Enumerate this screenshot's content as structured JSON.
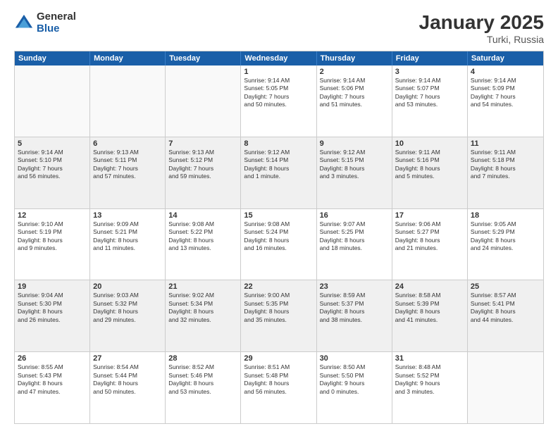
{
  "logo": {
    "general": "General",
    "blue": "Blue"
  },
  "title": "January 2025",
  "subtitle": "Turki, Russia",
  "header_days": [
    "Sunday",
    "Monday",
    "Tuesday",
    "Wednesday",
    "Thursday",
    "Friday",
    "Saturday"
  ],
  "weeks": [
    [
      {
        "day": "",
        "info": ""
      },
      {
        "day": "",
        "info": ""
      },
      {
        "day": "",
        "info": ""
      },
      {
        "day": "1",
        "info": "Sunrise: 9:14 AM\nSunset: 5:05 PM\nDaylight: 7 hours\nand 50 minutes."
      },
      {
        "day": "2",
        "info": "Sunrise: 9:14 AM\nSunset: 5:06 PM\nDaylight: 7 hours\nand 51 minutes."
      },
      {
        "day": "3",
        "info": "Sunrise: 9:14 AM\nSunset: 5:07 PM\nDaylight: 7 hours\nand 53 minutes."
      },
      {
        "day": "4",
        "info": "Sunrise: 9:14 AM\nSunset: 5:09 PM\nDaylight: 7 hours\nand 54 minutes."
      }
    ],
    [
      {
        "day": "5",
        "info": "Sunrise: 9:14 AM\nSunset: 5:10 PM\nDaylight: 7 hours\nand 56 minutes."
      },
      {
        "day": "6",
        "info": "Sunrise: 9:13 AM\nSunset: 5:11 PM\nDaylight: 7 hours\nand 57 minutes."
      },
      {
        "day": "7",
        "info": "Sunrise: 9:13 AM\nSunset: 5:12 PM\nDaylight: 7 hours\nand 59 minutes."
      },
      {
        "day": "8",
        "info": "Sunrise: 9:12 AM\nSunset: 5:14 PM\nDaylight: 8 hours\nand 1 minute."
      },
      {
        "day": "9",
        "info": "Sunrise: 9:12 AM\nSunset: 5:15 PM\nDaylight: 8 hours\nand 3 minutes."
      },
      {
        "day": "10",
        "info": "Sunrise: 9:11 AM\nSunset: 5:16 PM\nDaylight: 8 hours\nand 5 minutes."
      },
      {
        "day": "11",
        "info": "Sunrise: 9:11 AM\nSunset: 5:18 PM\nDaylight: 8 hours\nand 7 minutes."
      }
    ],
    [
      {
        "day": "12",
        "info": "Sunrise: 9:10 AM\nSunset: 5:19 PM\nDaylight: 8 hours\nand 9 minutes."
      },
      {
        "day": "13",
        "info": "Sunrise: 9:09 AM\nSunset: 5:21 PM\nDaylight: 8 hours\nand 11 minutes."
      },
      {
        "day": "14",
        "info": "Sunrise: 9:08 AM\nSunset: 5:22 PM\nDaylight: 8 hours\nand 13 minutes."
      },
      {
        "day": "15",
        "info": "Sunrise: 9:08 AM\nSunset: 5:24 PM\nDaylight: 8 hours\nand 16 minutes."
      },
      {
        "day": "16",
        "info": "Sunrise: 9:07 AM\nSunset: 5:25 PM\nDaylight: 8 hours\nand 18 minutes."
      },
      {
        "day": "17",
        "info": "Sunrise: 9:06 AM\nSunset: 5:27 PM\nDaylight: 8 hours\nand 21 minutes."
      },
      {
        "day": "18",
        "info": "Sunrise: 9:05 AM\nSunset: 5:29 PM\nDaylight: 8 hours\nand 24 minutes."
      }
    ],
    [
      {
        "day": "19",
        "info": "Sunrise: 9:04 AM\nSunset: 5:30 PM\nDaylight: 8 hours\nand 26 minutes."
      },
      {
        "day": "20",
        "info": "Sunrise: 9:03 AM\nSunset: 5:32 PM\nDaylight: 8 hours\nand 29 minutes."
      },
      {
        "day": "21",
        "info": "Sunrise: 9:02 AM\nSunset: 5:34 PM\nDaylight: 8 hours\nand 32 minutes."
      },
      {
        "day": "22",
        "info": "Sunrise: 9:00 AM\nSunset: 5:35 PM\nDaylight: 8 hours\nand 35 minutes."
      },
      {
        "day": "23",
        "info": "Sunrise: 8:59 AM\nSunset: 5:37 PM\nDaylight: 8 hours\nand 38 minutes."
      },
      {
        "day": "24",
        "info": "Sunrise: 8:58 AM\nSunset: 5:39 PM\nDaylight: 8 hours\nand 41 minutes."
      },
      {
        "day": "25",
        "info": "Sunrise: 8:57 AM\nSunset: 5:41 PM\nDaylight: 8 hours\nand 44 minutes."
      }
    ],
    [
      {
        "day": "26",
        "info": "Sunrise: 8:55 AM\nSunset: 5:43 PM\nDaylight: 8 hours\nand 47 minutes."
      },
      {
        "day": "27",
        "info": "Sunrise: 8:54 AM\nSunset: 5:44 PM\nDaylight: 8 hours\nand 50 minutes."
      },
      {
        "day": "28",
        "info": "Sunrise: 8:52 AM\nSunset: 5:46 PM\nDaylight: 8 hours\nand 53 minutes."
      },
      {
        "day": "29",
        "info": "Sunrise: 8:51 AM\nSunset: 5:48 PM\nDaylight: 8 hours\nand 56 minutes."
      },
      {
        "day": "30",
        "info": "Sunrise: 8:50 AM\nSunset: 5:50 PM\nDaylight: 9 hours\nand 0 minutes."
      },
      {
        "day": "31",
        "info": "Sunrise: 8:48 AM\nSunset: 5:52 PM\nDaylight: 9 hours\nand 3 minutes."
      },
      {
        "day": "",
        "info": ""
      }
    ]
  ]
}
